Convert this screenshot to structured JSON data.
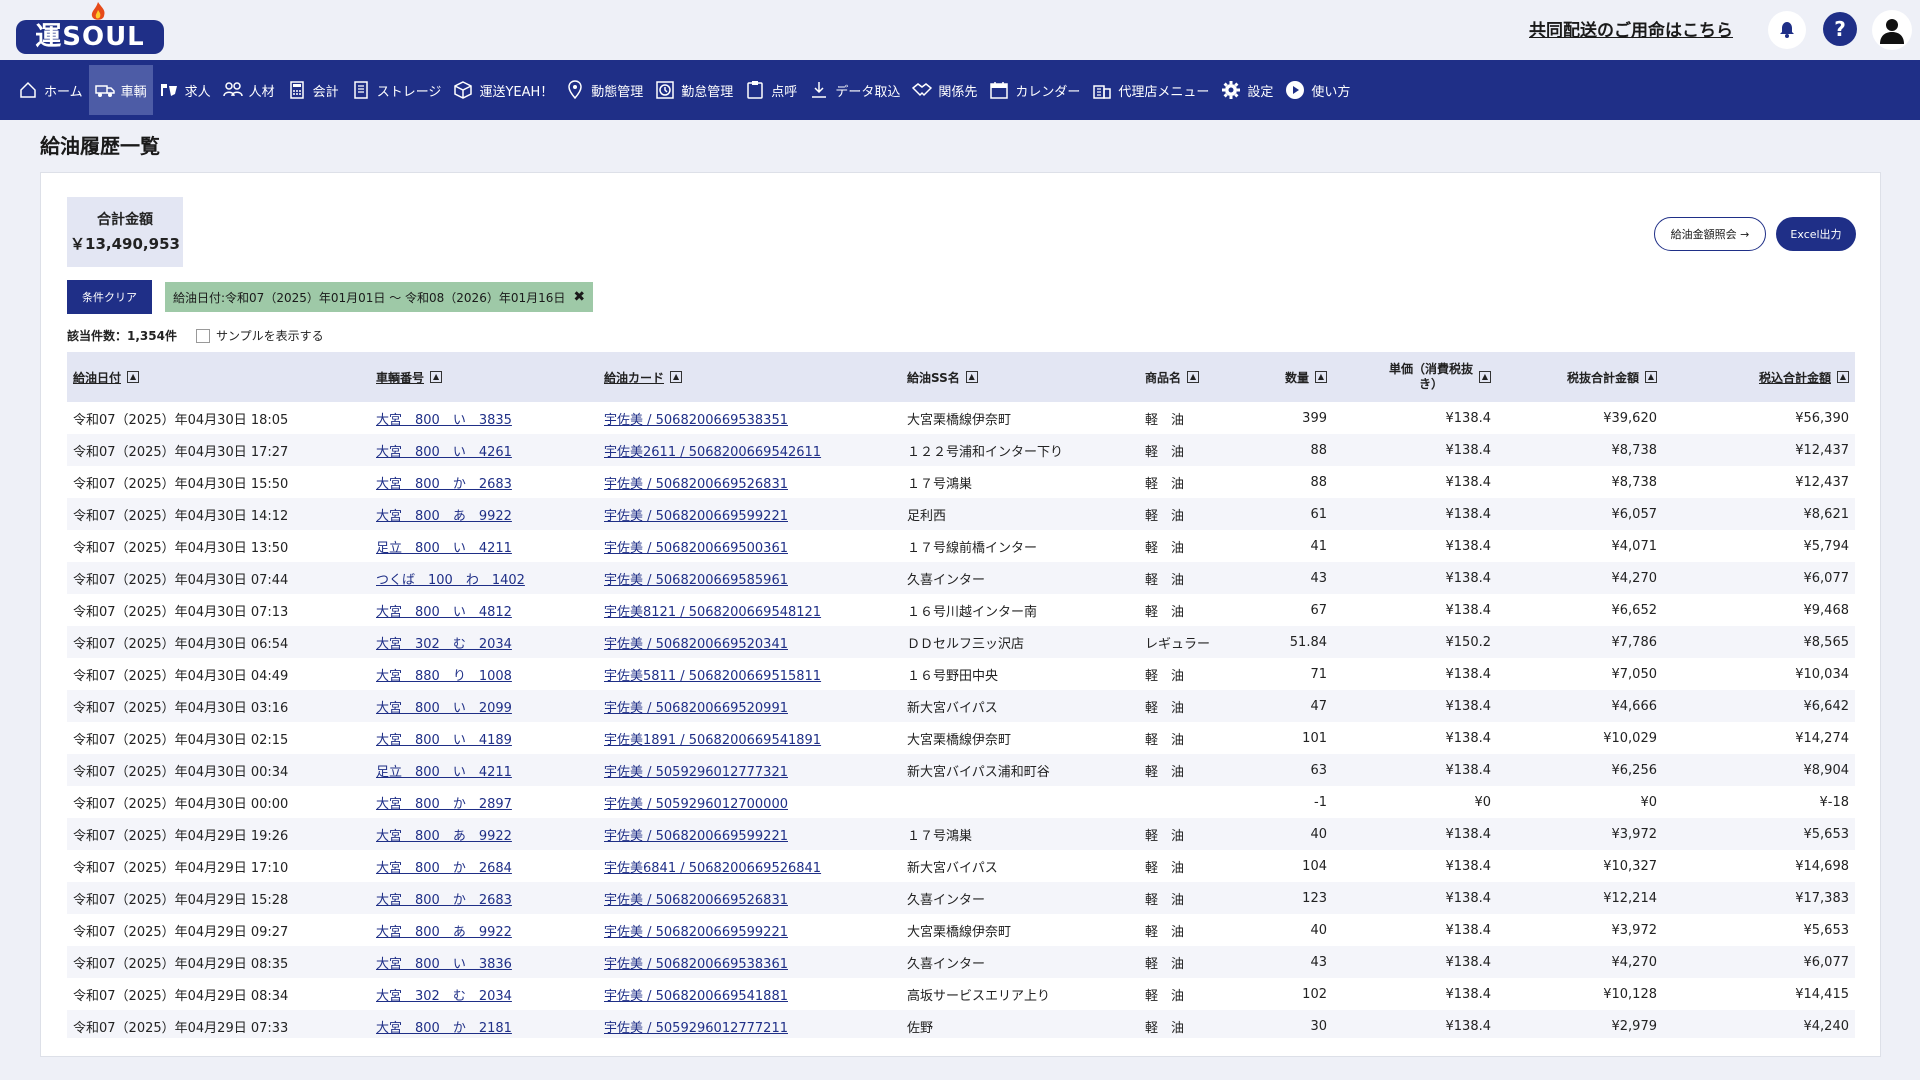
{
  "header": {
    "logo": "運SOUL",
    "contact_link": "共同配送のご用命はこちら",
    "help_label": "?"
  },
  "nav": {
    "items": [
      {
        "label": "ホーム",
        "icon": "home-icon"
      },
      {
        "label": "車輌",
        "icon": "truck-icon",
        "active": true
      },
      {
        "label": "求人",
        "icon": "job-icon"
      },
      {
        "label": "人材",
        "icon": "people-icon"
      },
      {
        "label": "会計",
        "icon": "calculator-icon"
      },
      {
        "label": "ストレージ",
        "icon": "document-icon"
      },
      {
        "label": "運送YEAH！",
        "icon": "box-icon"
      },
      {
        "label": "動態管理",
        "icon": "location-pin-icon"
      },
      {
        "label": "勤怠管理",
        "icon": "clock-icon"
      },
      {
        "label": "点呼",
        "icon": "clipboard-icon"
      },
      {
        "label": "データ取込",
        "icon": "download-icon"
      },
      {
        "label": "関係先",
        "icon": "handshake-icon"
      },
      {
        "label": "カレンダー",
        "icon": "calendar-icon"
      },
      {
        "label": "代理店メニュー",
        "icon": "building-icon"
      },
      {
        "label": "設定",
        "icon": "gear-icon"
      },
      {
        "label": "使い方",
        "icon": "play-icon"
      }
    ]
  },
  "page": {
    "title": "給油履歴一覧",
    "total_label": "合計金額",
    "total_value": "￥13,490,953",
    "btn_inquiry": "給油金額照会 →",
    "btn_excel": "Excel出力",
    "btn_clear": "条件クリア",
    "filter_chip": "給油日付:令和07（2025）年01月01日 ～ 令和08（2026）年01月16日",
    "count_text": "該当件数：1,354件",
    "sample_label": "サンプルを表示する"
  },
  "table": {
    "columns": [
      "給油日付",
      "車輌番号",
      "給油カード",
      "給油SS名",
      "商品名",
      "数量",
      "単価（消費税抜き）",
      "税抜合計金額",
      "税込合計金額"
    ],
    "rows": [
      [
        "令和07（2025）年04月30日 18:05",
        "大宮　800　い　3835",
        "宇佐美 / 5068200669538351",
        "大宮栗橋線伊奈町",
        "軽　油",
        "399",
        "¥138.4",
        "¥39,620",
        "¥56,390"
      ],
      [
        "令和07（2025）年04月30日 17:27",
        "大宮　800　い　4261",
        "宇佐美2611 / 5068200669542611",
        "１２２号浦和インター下り",
        "軽　油",
        "88",
        "¥138.4",
        "¥8,738",
        "¥12,437"
      ],
      [
        "令和07（2025）年04月30日 15:50",
        "大宮　800　か　2683",
        "宇佐美 / 5068200669526831",
        "１７号鴻巣",
        "軽　油",
        "88",
        "¥138.4",
        "¥8,738",
        "¥12,437"
      ],
      [
        "令和07（2025）年04月30日 14:12",
        "大宮　800　あ　9922",
        "宇佐美 / 5068200669599221",
        "足利西",
        "軽　油",
        "61",
        "¥138.4",
        "¥6,057",
        "¥8,621"
      ],
      [
        "令和07（2025）年04月30日 13:50",
        "足立　800　い　4211",
        "宇佐美 / 5068200669500361",
        "１７号線前橋インター",
        "軽　油",
        "41",
        "¥138.4",
        "¥4,071",
        "¥5,794"
      ],
      [
        "令和07（2025）年04月30日 07:44",
        "つくば　100　わ　1402",
        "宇佐美 / 5068200669585961",
        "久喜インター",
        "軽　油",
        "43",
        "¥138.4",
        "¥4,270",
        "¥6,077"
      ],
      [
        "令和07（2025）年04月30日 07:13",
        "大宮　800　い　4812",
        "宇佐美8121 / 5068200669548121",
        "１６号川越インター南",
        "軽　油",
        "67",
        "¥138.4",
        "¥6,652",
        "¥9,468"
      ],
      [
        "令和07（2025）年04月30日 06:54",
        "大宮　302　む　2034",
        "宇佐美 / 5068200669520341",
        "ＤＤセルフ三ッ沢店",
        "レギュラー",
        "51.84",
        "¥150.2",
        "¥7,786",
        "¥8,565"
      ],
      [
        "令和07（2025）年04月30日 04:49",
        "大宮　880　り　1008",
        "宇佐美5811 / 5068200669515811",
        "１６号野田中央",
        "軽　油",
        "71",
        "¥138.4",
        "¥7,050",
        "¥10,034"
      ],
      [
        "令和07（2025）年04月30日 03:16",
        "大宮　800　い　2099",
        "宇佐美 / 5068200669520991",
        "新大宮バイパス",
        "軽　油",
        "47",
        "¥138.4",
        "¥4,666",
        "¥6,642"
      ],
      [
        "令和07（2025）年04月30日 02:15",
        "大宮　800　い　4189",
        "宇佐美1891 / 5068200669541891",
        "大宮栗橋線伊奈町",
        "軽　油",
        "101",
        "¥138.4",
        "¥10,029",
        "¥14,274"
      ],
      [
        "令和07（2025）年04月30日 00:34",
        "足立　800　い　4211",
        "宇佐美 / 5059296012777321",
        "新大宮バイパス浦和町谷",
        "軽　油",
        "63",
        "¥138.4",
        "¥6,256",
        "¥8,904"
      ],
      [
        "令和07（2025）年04月30日 00:00",
        "大宮　800　か　2897",
        "宇佐美 / 5059296012700000",
        "",
        "",
        "-1",
        "¥0",
        "¥0",
        "¥-18"
      ],
      [
        "令和07（2025）年04月29日 19:26",
        "大宮　800　あ　9922",
        "宇佐美 / 5068200669599221",
        "１７号鴻巣",
        "軽　油",
        "40",
        "¥138.4",
        "¥3,972",
        "¥5,653"
      ],
      [
        "令和07（2025）年04月29日 17:10",
        "大宮　800　か　2684",
        "宇佐美6841 / 5068200669526841",
        "新大宮バイパス",
        "軽　油",
        "104",
        "¥138.4",
        "¥10,327",
        "¥14,698"
      ],
      [
        "令和07（2025）年04月29日 15:28",
        "大宮　800　か　2683",
        "宇佐美 / 5068200669526831",
        "久喜インター",
        "軽　油",
        "123",
        "¥138.4",
        "¥12,214",
        "¥17,383"
      ],
      [
        "令和07（2025）年04月29日 09:27",
        "大宮　800　あ　9922",
        "宇佐美 / 5068200669599221",
        "大宮栗橋線伊奈町",
        "軽　油",
        "40",
        "¥138.4",
        "¥3,972",
        "¥5,653"
      ],
      [
        "令和07（2025）年04月29日 08:35",
        "大宮　800　い　3836",
        "宇佐美 / 5068200669538361",
        "久喜インター",
        "軽　油",
        "43",
        "¥138.4",
        "¥4,270",
        "¥6,077"
      ],
      [
        "令和07（2025）年04月29日 08:34",
        "大宮　302　む　2034",
        "宇佐美 / 5068200669541881",
        "高坂サービスエリア上り",
        "軽　油",
        "102",
        "¥138.4",
        "¥10,128",
        "¥14,415"
      ],
      [
        "令和07（2025）年04月29日 07:33",
        "大宮　800　か　2181",
        "宇佐美 / 5059296012777211",
        "佐野",
        "軽　油",
        "30",
        "¥138.4",
        "¥2,979",
        "¥4,240"
      ]
    ]
  },
  "colors": {
    "brand": "#1f2f87",
    "nav_active": "#4d5ca6",
    "header_row": "#e3e6f3",
    "chip": "#9ec9a7"
  }
}
